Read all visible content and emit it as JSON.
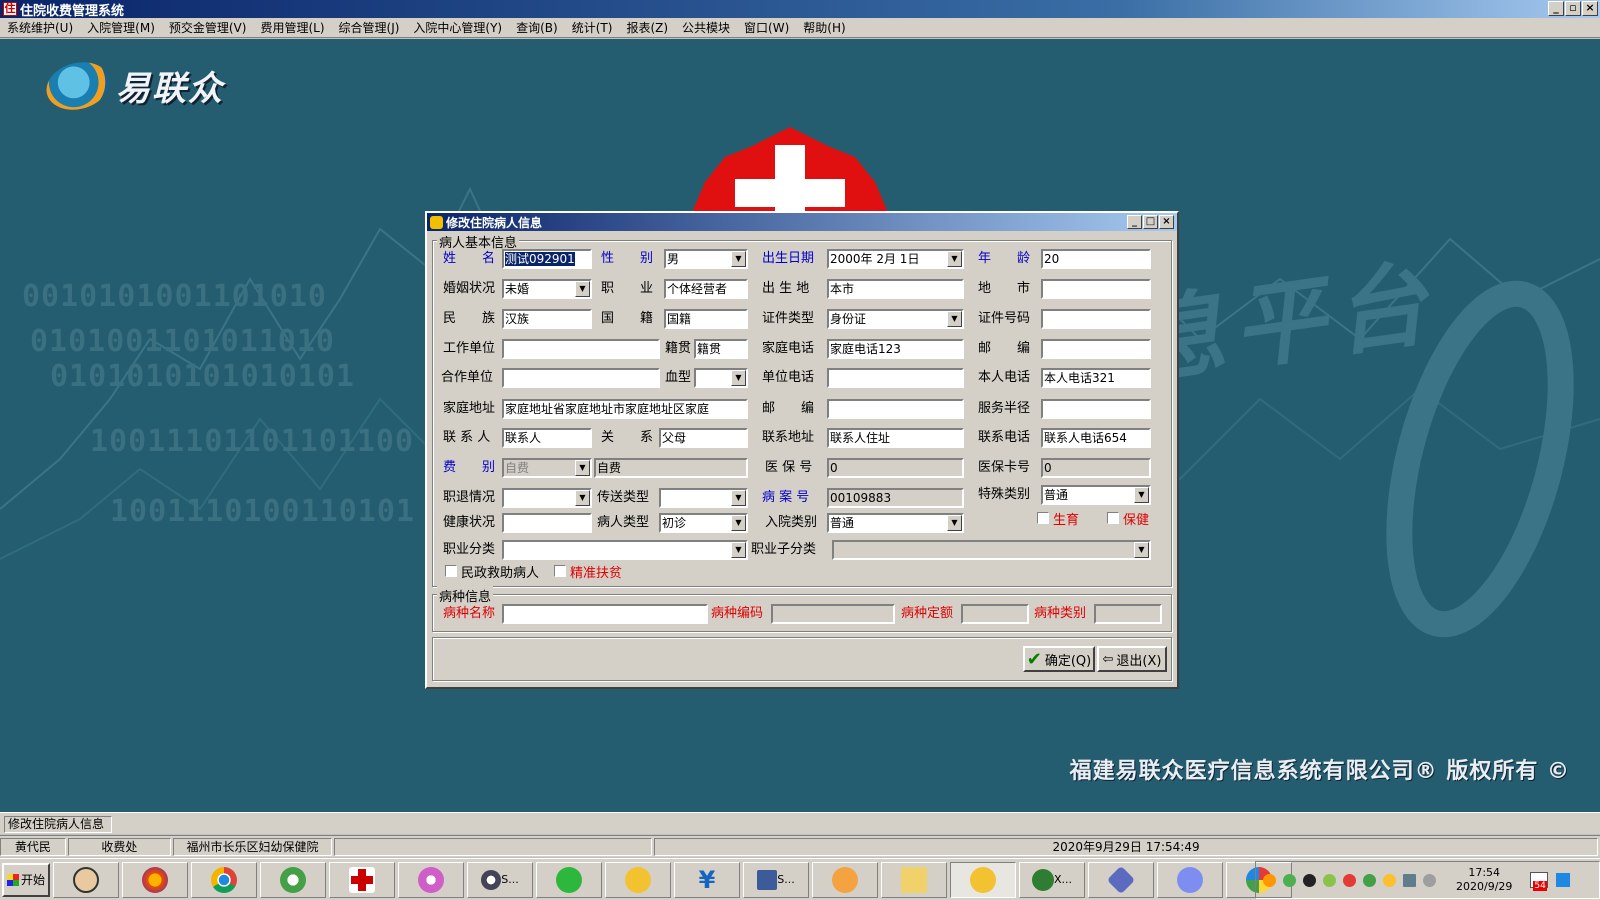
{
  "window": {
    "title": "住院收费管理系统",
    "controls": [
      "_",
      "▫",
      "×"
    ]
  },
  "menu": [
    "系统维护(U)",
    "入院管理(M)",
    "预交金管理(V)",
    "费用管理(L)",
    "综合管理(J)",
    "入院中心管理(Y)",
    "查询(B)",
    "统计(T)",
    "报表(Z)",
    "公共模块",
    "窗口(W)",
    "帮助(H)"
  ],
  "brand": {
    "logo_text": "易联众",
    "bg_text": "息平台",
    "copyright": "福建易联众医疗信息系统有限公司® 版权所有 ©"
  },
  "background_binary": [
    "0010101001101010",
    "0101001101011010",
    "0101010101010101",
    "10011101101101100",
    "1001110100110101"
  ],
  "dialog": {
    "title": "修改住院病人信息",
    "group_basic": "病人基本信息",
    "group_disease": "病种信息",
    "fields": {
      "name": {
        "label": "姓　　名",
        "value": "测试092901"
      },
      "sex": {
        "label": "性　　别",
        "value": "男"
      },
      "birth": {
        "label": "出生日期",
        "value": "2000年  2月  1日"
      },
      "age": {
        "label": "年　　龄",
        "value": "20"
      },
      "marital": {
        "label": "婚姻状况",
        "value": "未婚"
      },
      "occupation": {
        "label": "职　　业",
        "value": "个体经营者"
      },
      "birthplace": {
        "label": "出 生 地",
        "value": "本市"
      },
      "city": {
        "label": "地　　市",
        "value": ""
      },
      "ethnic": {
        "label": "民　　族",
        "value": "汉族"
      },
      "nationality": {
        "label": "国　　籍",
        "value": "国籍"
      },
      "idtype": {
        "label": "证件类型",
        "value": "身份证"
      },
      "idno": {
        "label": "证件号码",
        "value": ""
      },
      "workunit": {
        "label": "工作单位",
        "value": ""
      },
      "native": {
        "label": "籍贯",
        "value": "籍贯"
      },
      "homephone": {
        "label": "家庭电话",
        "value": "家庭电话123"
      },
      "postcode1": {
        "label": "邮　　编",
        "value": ""
      },
      "coopunit": {
        "label": "合作单位",
        "value": ""
      },
      "blood": {
        "label": "血型",
        "value": ""
      },
      "unitphone": {
        "label": "单位电话",
        "value": ""
      },
      "selfphone": {
        "label": "本人电话",
        "value": "本人电话321"
      },
      "homeaddr": {
        "label": "家庭地址",
        "value": "家庭地址省家庭地址市家庭地址区家庭"
      },
      "postcode2": {
        "label": "邮　　编",
        "value": ""
      },
      "radius": {
        "label": "服务半径",
        "value": ""
      },
      "contact": {
        "label": "联 系 人",
        "value": "联系人"
      },
      "relation": {
        "label": "关　　系",
        "value": "父母"
      },
      "contactaddr": {
        "label": "联系地址",
        "value": "联系人住址"
      },
      "contactphone": {
        "label": "联系电话",
        "value": "联系人电话654"
      },
      "feetype": {
        "label": "费　　别",
        "value": "自费",
        "value2": "自费"
      },
      "insno": {
        "label": "医 保 号",
        "value": "0"
      },
      "inscard": {
        "label": "医保卡号",
        "value": "0"
      },
      "retire": {
        "label": "职退情况",
        "value": ""
      },
      "sendtype": {
        "label": "传送类型",
        "value": ""
      },
      "caseno": {
        "label": "病 案 号",
        "value": "00109883"
      },
      "special": {
        "label": "特殊类别",
        "value": "普通"
      },
      "health": {
        "label": "健康状况",
        "value": ""
      },
      "pattype": {
        "label": "病人类型",
        "value": "初诊"
      },
      "admtype": {
        "label": "入院类别",
        "value": "普通"
      },
      "occcat": {
        "label": "职业分类",
        "value": ""
      },
      "occsub": {
        "label": "职业子分类",
        "value": ""
      }
    },
    "checks": {
      "birth_care": "生育",
      "health_care": "保健",
      "civil_aid": "民政救助病人",
      "poverty": "精准扶贫"
    },
    "disease": {
      "name_label": "病种名称",
      "name_value": "",
      "code_label": "病种编码",
      "code_value": "",
      "quota_label": "病种定额",
      "quota_value": "",
      "cat_label": "病种类别",
      "cat_value": ""
    },
    "buttons": {
      "ok": "确定(Q)",
      "exit": "退出(X)"
    }
  },
  "status": {
    "pane1": "修改住院病人信息",
    "user": "黄代民",
    "dept": "收费处",
    "hospital": "福州市长乐区妇幼保健院",
    "datetime": "2020年9月29日  17:54:49"
  },
  "taskbar": {
    "start": "开始",
    "items": [
      {
        "icon": "user-avatar-icon",
        "label": ""
      },
      {
        "icon": "firefox-icon",
        "label": ""
      },
      {
        "icon": "chrome-icon",
        "label": ""
      },
      {
        "icon": "ie-icon",
        "label": ""
      },
      {
        "icon": "medical-app-icon",
        "label": ""
      },
      {
        "icon": "flower-app-icon",
        "label": ""
      },
      {
        "icon": "compass-icon",
        "label": "S..."
      },
      {
        "icon": "wechat-icon",
        "label": ""
      },
      {
        "icon": "coins-icon",
        "label": ""
      },
      {
        "icon": "yuan-icon",
        "label": ""
      },
      {
        "icon": "sql-icon",
        "label": "S..."
      },
      {
        "icon": "cartoon-icon",
        "label": ""
      },
      {
        "icon": "folder-icon",
        "label": ""
      },
      {
        "icon": "coins-active-icon",
        "label": ""
      },
      {
        "icon": "xshell-icon",
        "label": "X..."
      },
      {
        "icon": "gem-icon",
        "label": ""
      },
      {
        "icon": "cloud-icon",
        "label": ""
      },
      {
        "icon": "paint-icon",
        "label": ""
      }
    ],
    "clock_time": "17:54",
    "clock_date": "2020/9/29",
    "badge": "54"
  },
  "colors": {
    "desktop": "#245d6f",
    "titlebar": "#0a246a",
    "label_blue": "#0000cc",
    "label_red": "#e00000"
  }
}
